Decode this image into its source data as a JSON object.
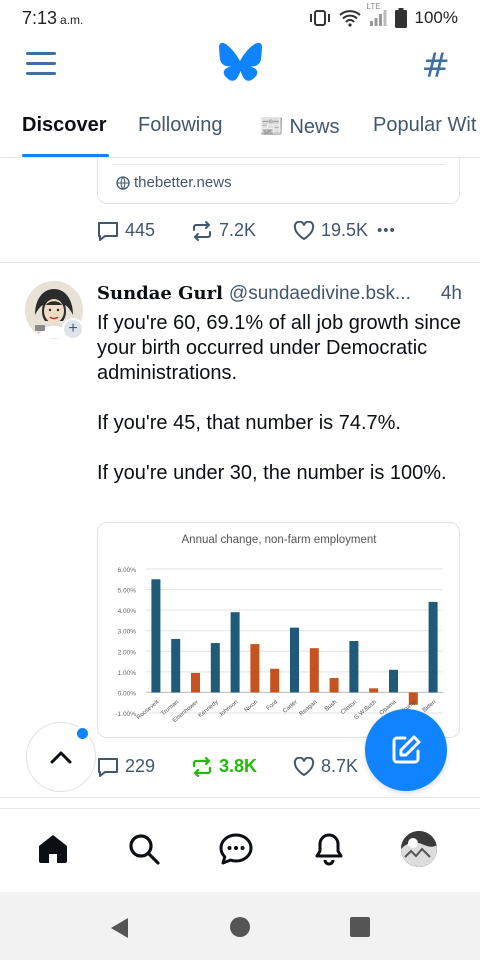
{
  "status_bar": {
    "time": "7:13",
    "ampm": "a.m.",
    "network": "LTE",
    "battery": "100%"
  },
  "header": {
    "menu_icon": "menu-icon",
    "logo_icon": "butterfly-icon",
    "feeds_icon": "hash-icon",
    "brand_color": "#1083fe"
  },
  "tabs": [
    {
      "label": "Discover",
      "active": true
    },
    {
      "label": "Following",
      "active": false
    },
    {
      "label": "📰 News",
      "active": false
    },
    {
      "label": "Popular Wit",
      "active": false
    }
  ],
  "prev_post": {
    "link_domain": "thebetter.news",
    "replies": "445",
    "reposts": "7.2K",
    "likes": "19.5K",
    "more_label": "•••"
  },
  "post": {
    "display_name": "Sundae Gurl",
    "handle": "@sundaedivine.bsk...",
    "time": "4h",
    "text": "If you're 60, 69.1% of all job growth since your birth occurred under Democratic administrations.\n\nIf you're 45, that number is 74.7%.\n\nIf you're under 30, the number is 100%.",
    "replies": "229",
    "reposts": "3.8K",
    "likes": "8.7K",
    "repost_color": "#20bc07"
  },
  "chart_data": {
    "type": "bar",
    "title": "Annual change, non-farm employment",
    "categories": [
      "Roosevelt",
      "Truman",
      "Eisenhower",
      "Kennedy",
      "Johnson",
      "Nixon",
      "Ford",
      "Carter",
      "Reagan",
      "Bush",
      "Clinton",
      "G.W.Bush",
      "Obama",
      "Trump",
      "Biden"
    ],
    "values": [
      5.5,
      2.6,
      0.95,
      2.4,
      3.9,
      2.35,
      1.15,
      3.15,
      2.15,
      0.7,
      2.5,
      0.2,
      1.1,
      -0.6,
      4.4
    ],
    "colors": [
      "#1f5a78",
      "#1f5a78",
      "#c5531f",
      "#1f5a78",
      "#1f5a78",
      "#c5531f",
      "#c5531f",
      "#1f5a78",
      "#c5531f",
      "#c5531f",
      "#1f5a78",
      "#c5531f",
      "#1f5a78",
      "#c5531f",
      "#1f5a78"
    ],
    "ylim": [
      -1.0,
      6.0
    ],
    "yticks": [
      "-1.00%",
      "0.00%",
      "1.00%",
      "2.00%",
      "3.00%",
      "4.00%",
      "5.00%",
      "6.00%"
    ],
    "grid": true,
    "legend": "none"
  },
  "bottom_nav": [
    "home-icon",
    "search-icon",
    "chat-icon",
    "bell-icon",
    "profile-avatar"
  ]
}
